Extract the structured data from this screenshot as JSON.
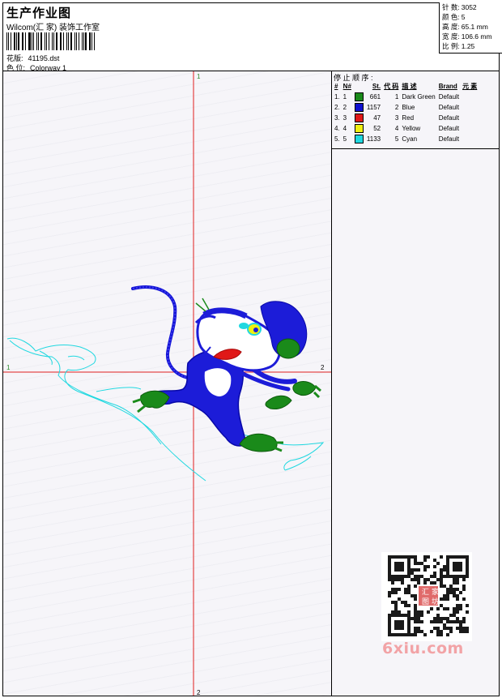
{
  "header": {
    "title": "生产作业图",
    "company": "Wilcom(汇 家) 装饰工作室",
    "design_label": "花版:",
    "design_value": "41195.dst",
    "colorway_label": "色 位:",
    "colorway_value": "Colorway 1"
  },
  "stats": [
    {
      "label": "针 数:",
      "value": "3052"
    },
    {
      "label": "颜 色:",
      "value": "5"
    },
    {
      "label": "高 度:",
      "value": "65.1 mm"
    },
    {
      "label": "宽 度:",
      "value": "106.6 mm"
    },
    {
      "label": "比 例:",
      "value": "1.25"
    }
  ],
  "canvas": {
    "axis_top": "1",
    "axis_left": "1",
    "axis_right": "2",
    "axis_bottom": "2",
    "axis_color": "#e02020"
  },
  "side": {
    "stop_title": "停 止 顺 序 :",
    "headers": [
      "#",
      "N#",
      "St.",
      "代 码",
      "描 述",
      "Brand",
      "元 素"
    ],
    "rows": [
      {
        "idx": "1.",
        "n": "1",
        "color": "#1a8a1a",
        "stitches": "661",
        "code": "1",
        "desc": "Dark Green",
        "brand": "Default"
      },
      {
        "idx": "2.",
        "n": "2",
        "color": "#1010d0",
        "stitches": "1157",
        "code": "2",
        "desc": "Blue",
        "brand": "Default"
      },
      {
        "idx": "3.",
        "n": "3",
        "color": "#e01818",
        "stitches": "47",
        "code": "3",
        "desc": "Red",
        "brand": "Default"
      },
      {
        "idx": "4.",
        "n": "4",
        "color": "#f0f010",
        "stitches": "52",
        "code": "4",
        "desc": "Yellow",
        "brand": "Default"
      },
      {
        "idx": "5.",
        "n": "5",
        "color": "#20d8e0",
        "stitches": "1133",
        "code": "5",
        "desc": "Cyan",
        "brand": "Default"
      }
    ]
  },
  "watermark": {
    "logo_text": "6xiu.com",
    "seal_text": "汇家图坊"
  }
}
